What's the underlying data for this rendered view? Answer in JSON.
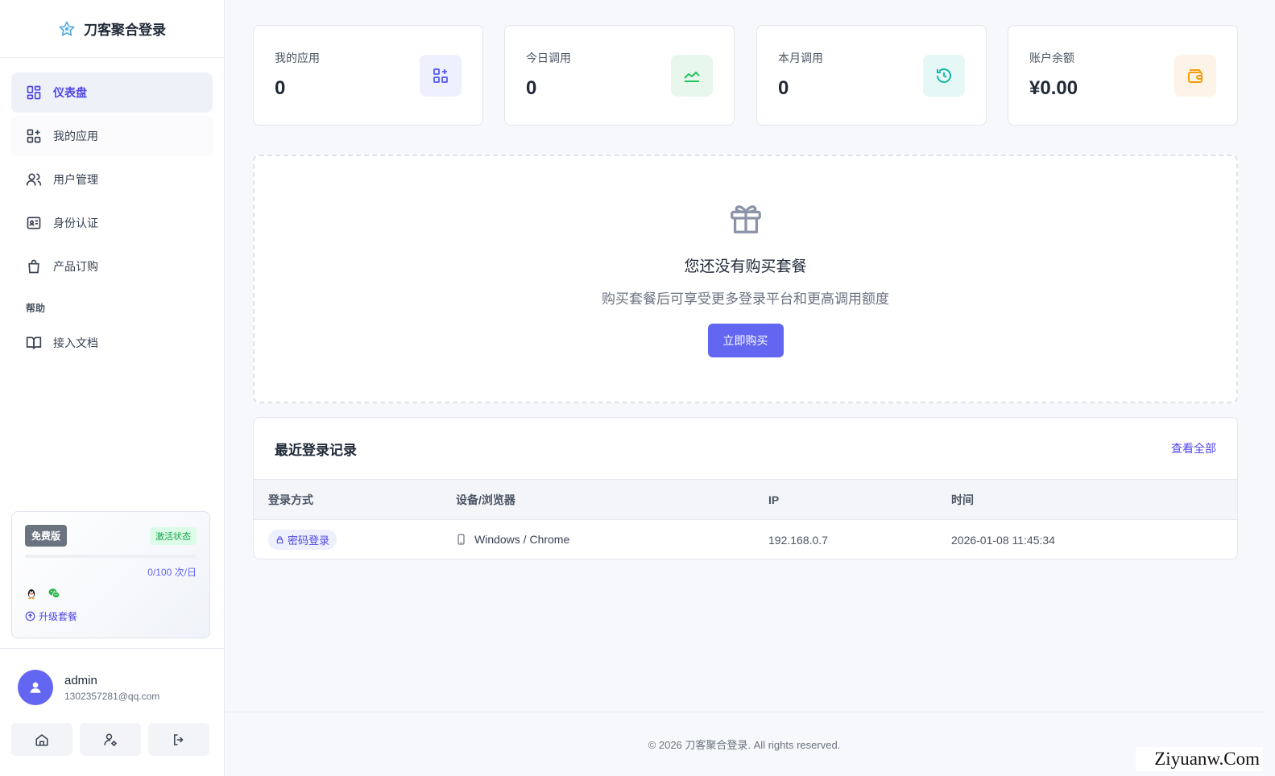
{
  "brand": {
    "name": "刀客聚合登录"
  },
  "nav": {
    "items": [
      {
        "label": "仪表盘",
        "icon": "dashboard-icon",
        "active": true
      },
      {
        "label": "我的应用",
        "icon": "apps-add-icon",
        "active": false
      },
      {
        "label": "用户管理",
        "icon": "users-icon",
        "active": false
      },
      {
        "label": "身份认证",
        "icon": "id-card-icon",
        "active": false
      },
      {
        "label": "产品订购",
        "icon": "shopping-bag-icon",
        "active": false
      }
    ],
    "help_section": "帮助",
    "help_items": [
      {
        "label": "接入文档",
        "icon": "book-icon"
      }
    ]
  },
  "plan": {
    "badge": "免费版",
    "status": "激活状态",
    "quota": "0/100 次/日",
    "usage_fraction": 0.0,
    "upgrade": "升级套餐",
    "icons": [
      "qq-icon",
      "wechat-icon"
    ]
  },
  "user": {
    "name": "admin",
    "email": "1302357281@qq.com"
  },
  "sidebar_footer": [
    "home-icon",
    "user-settings-icon",
    "logout-icon"
  ],
  "stats": [
    {
      "label": "我的应用",
      "value": "0",
      "icon": "apps-add-icon",
      "color": "#6366f1",
      "bg": "#eef0fd"
    },
    {
      "label": "今日调用",
      "value": "0",
      "icon": "trend-line-icon",
      "color": "#22c55e",
      "bg": "#e8f7ec"
    },
    {
      "label": "本月调用",
      "value": "0",
      "icon": "history-icon",
      "color": "#14b8a6",
      "bg": "#e6f8f6"
    },
    {
      "label": "账户余额",
      "value": "¥0.00",
      "icon": "wallet-icon",
      "color": "#f59e0b",
      "bg": "#fdf3e6"
    }
  ],
  "empty": {
    "title": "您还没有购买套餐",
    "description": "购买套餐后可享受更多登录平台和更高调用额度",
    "button": "立即购买"
  },
  "records": {
    "title": "最近登录记录",
    "view_all": "查看全部",
    "columns": [
      "登录方式",
      "设备/浏览器",
      "IP",
      "时间"
    ],
    "rows": [
      {
        "method": "密码登录",
        "device": "Windows / Chrome",
        "ip": "192.168.0.7",
        "time": "2026-01-08 11:45:34"
      }
    ]
  },
  "footer": {
    "copyright": "© 2026 刀客聚合登录. All rights reserved."
  },
  "watermark": "Ziyuanw.Com",
  "colors": {
    "accent": "#6366f1",
    "success": "#16a34a"
  }
}
